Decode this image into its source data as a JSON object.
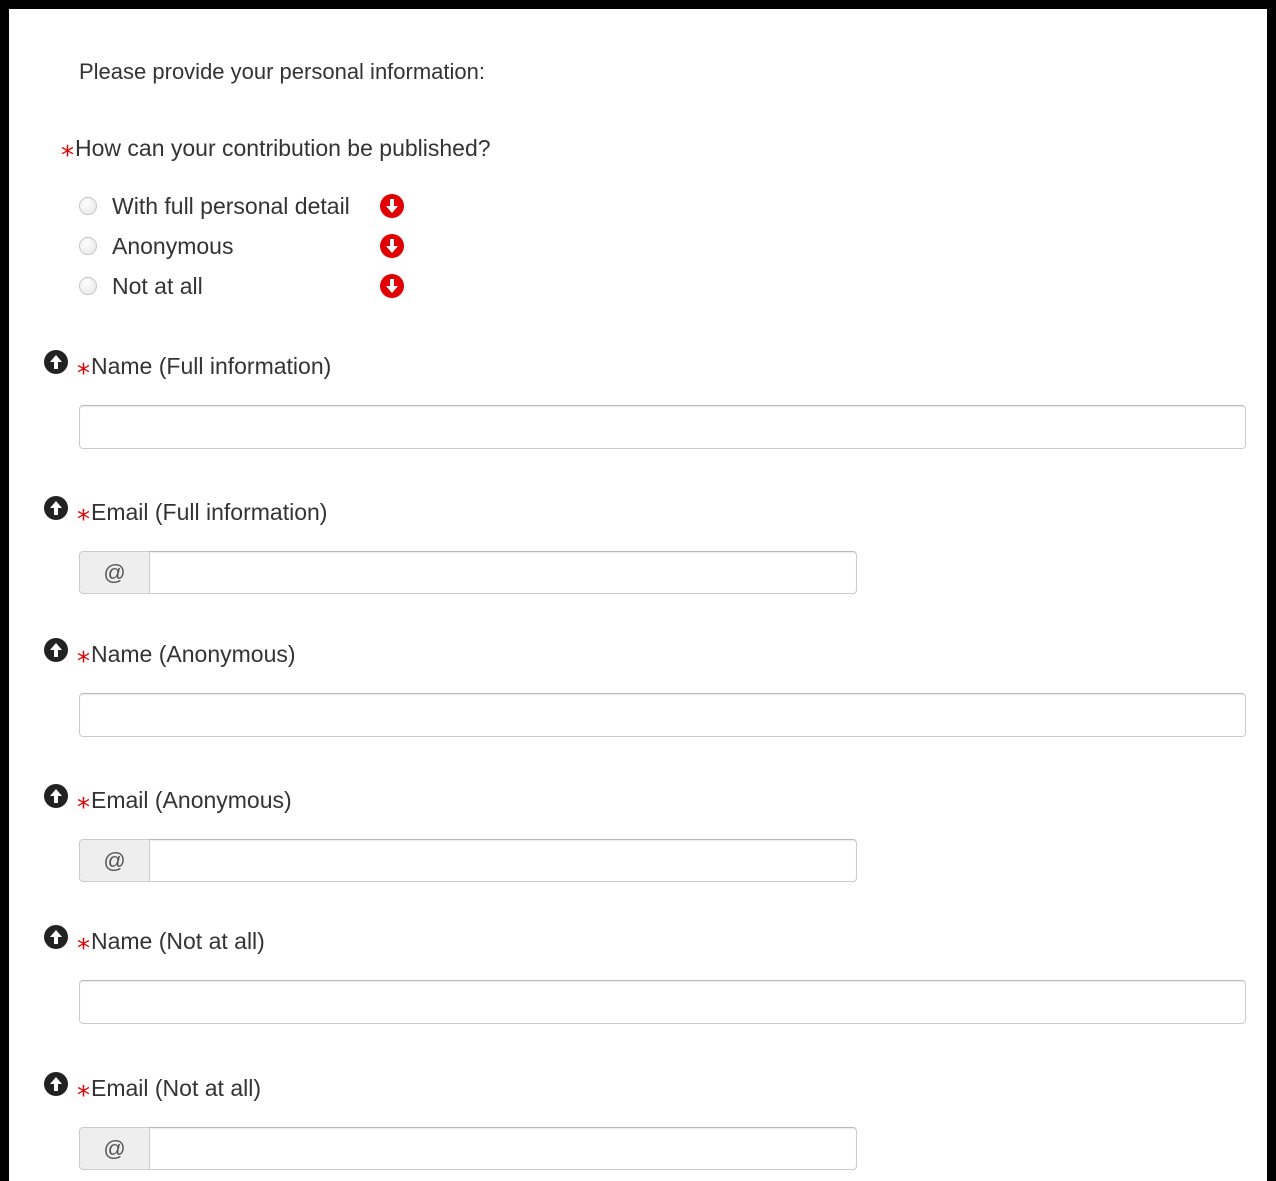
{
  "intro": "Please provide your personal information:",
  "question": {
    "required_mark": "*",
    "text": "How can your contribution be published?"
  },
  "options": [
    {
      "label": "With full personal detail",
      "selected": false
    },
    {
      "label": "Anonymous",
      "selected": false
    },
    {
      "label": "Not at all",
      "selected": false
    }
  ],
  "fields": {
    "name_full": {
      "required_mark": "*",
      "label": "Name (Full information)",
      "value": ""
    },
    "email_full": {
      "required_mark": "*",
      "label": "Email (Full information)",
      "addon": "@",
      "value": ""
    },
    "name_anon": {
      "required_mark": "*",
      "label": "Name (Anonymous)",
      "value": ""
    },
    "email_anon": {
      "required_mark": "*",
      "label": "Email (Anonymous)",
      "addon": "@",
      "value": ""
    },
    "name_none": {
      "required_mark": "*",
      "label": "Name (Not at all)",
      "value": ""
    },
    "email_none": {
      "required_mark": "*",
      "label": "Email (Not at all)",
      "addon": "@",
      "value": ""
    }
  },
  "icons": {
    "option_icon": "arrow-down-circle-icon",
    "field_icon": "arrow-up-circle-icon"
  },
  "colors": {
    "required": "#e00000",
    "down_icon": "#e00000",
    "up_icon": "#222222"
  }
}
